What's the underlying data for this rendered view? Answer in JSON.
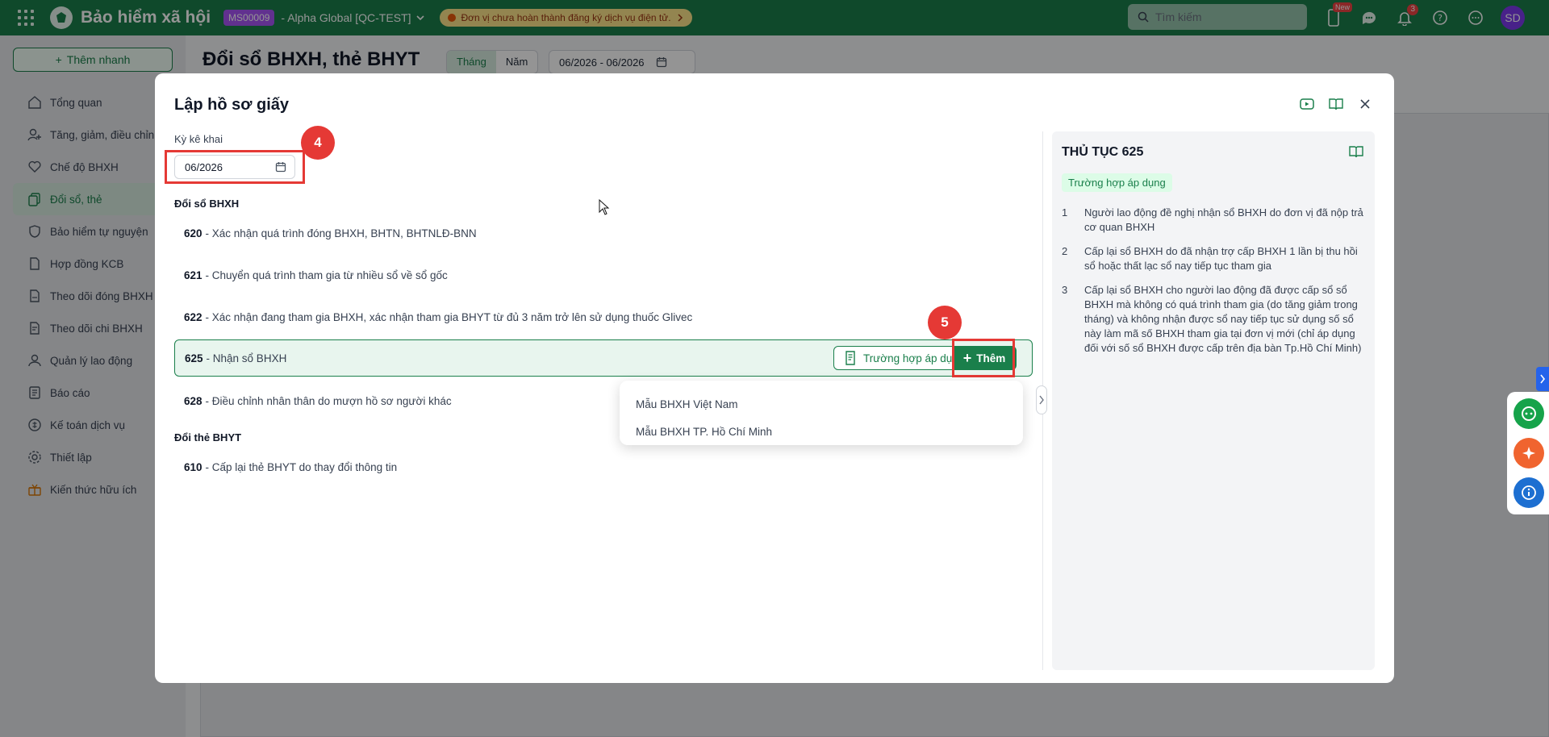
{
  "topbar": {
    "app_title": "Bảo hiểm xã hội",
    "org_code": "MS00009",
    "company": "- Alpha Global [QC-TEST]",
    "warning": "Đơn vị chưa hoàn thành đăng ký dịch vụ điện tử.",
    "search_placeholder": "Tìm kiếm",
    "new_badge": "New",
    "notification_count": "3",
    "avatar": "SD",
    "brand_color": "#1a7f4b"
  },
  "sidebar": {
    "quick_add": "Thêm nhanh",
    "items": [
      {
        "label": "Tổng quan",
        "icon": "home-icon"
      },
      {
        "label": "Tăng, giảm, điều chỉnh",
        "icon": "user-plus-icon"
      },
      {
        "label": "Chế độ BHXH",
        "icon": "heart-icon"
      },
      {
        "label": "Đổi sổ, thẻ",
        "icon": "copy-icon",
        "active": true
      },
      {
        "label": "Bảo hiểm tự nguyện",
        "icon": "shield-icon"
      },
      {
        "label": "Hợp đồng KCB",
        "icon": "file-icon"
      },
      {
        "label": "Theo dõi đóng BHXH",
        "icon": "c12-icon"
      },
      {
        "label": "Theo dõi chi BHXH",
        "icon": "c70-icon"
      },
      {
        "label": "Quản lý lao động",
        "icon": "user-icon"
      },
      {
        "label": "Báo cáo",
        "icon": "report-icon"
      },
      {
        "label": "Kế toán dịch vụ",
        "icon": "calc-icon"
      },
      {
        "label": "Thiết lập",
        "icon": "gear-icon"
      },
      {
        "label": "Kiến thức hữu ích",
        "icon": "gift-icon"
      }
    ]
  },
  "page": {
    "title": "Đổi sổ BHXH, thẻ BHYT",
    "toggle_month": "Tháng",
    "toggle_year": "Năm",
    "date_range": "06/2026 - 06/2026"
  },
  "modal": {
    "title": "Lập hồ sơ giấy",
    "period_label": "Kỳ kê khai",
    "period_value": "06/2026",
    "step4": "4",
    "step5": "5",
    "section_so": "Đổi sổ BHXH",
    "section_the": "Đổi thẻ BHYT",
    "procedures": [
      {
        "code": "620",
        "name": "- Xác nhận quá trình đóng BHXH, BHTN, BHTNLĐ-BNN"
      },
      {
        "code": "621",
        "name": "- Chuyển quá trình tham gia từ nhiều sổ về sổ gốc"
      },
      {
        "code": "622",
        "name": "- Xác nhận đang tham gia BHXH, xác nhận tham gia BHYT từ đủ 3 năm trở lên sử dụng thuốc Glivec"
      },
      {
        "code": "625",
        "name": "- Nhận sổ BHXH"
      },
      {
        "code": "628",
        "name": "- Điều chỉnh nhân thân do mượn hồ sơ người khác"
      },
      {
        "code": "610",
        "name": "- Cấp lại thẻ BHYT do thay đổi thông tin"
      }
    ],
    "case_button": "Trường hợp áp dụng",
    "add_button": "Thêm",
    "dropdown": [
      "Mẫu BHXH Việt Nam",
      "Mẫu BHXH TP. Hồ Chí Minh"
    ],
    "right_panel": {
      "title": "THỦ TỤC 625",
      "tag": "Trường hợp áp dụng",
      "items": [
        {
          "n": "1",
          "text": "Người lao động đề nghị nhận sổ BHXH do đơn vị đã nộp trả cơ quan BHXH"
        },
        {
          "n": "2",
          "text": "Cấp lại sổ BHXH do đã nhận trợ cấp BHXH 1 lần bị thu hồi sổ hoặc thất lạc sổ nay tiếp tục tham gia"
        },
        {
          "n": "3",
          "text": "Cấp lại sổ BHXH cho người lao động đã được cấp sổ sổ BHXH mà không có quá trình tham gia (do tăng giảm trong tháng) và không nhận được sổ nay tiếp tục sử dụng số sổ này làm mã số BHXH tham gia tại đơn vị mới (chỉ áp dụng đối với số sổ BHXH được cấp trên địa bàn Tp.Hồ Chí Minh)"
        }
      ]
    }
  }
}
